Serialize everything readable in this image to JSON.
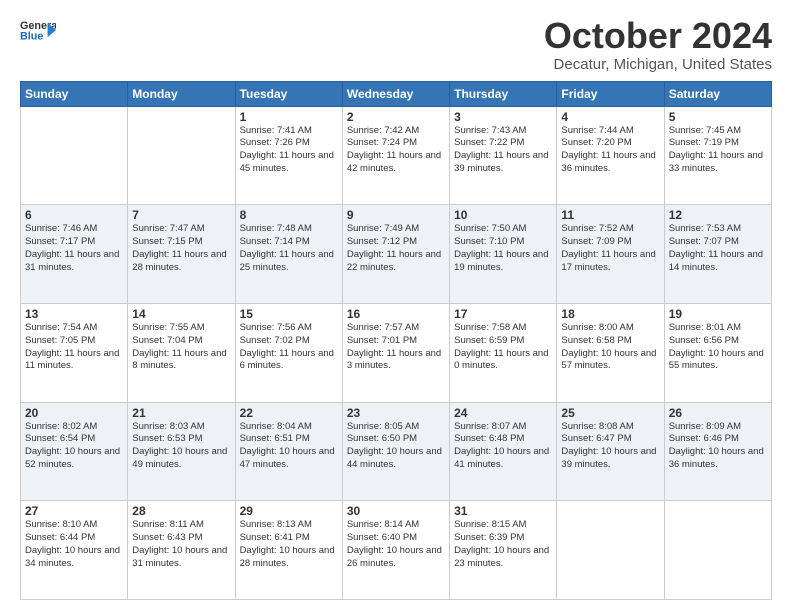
{
  "header": {
    "logo_line1": "General",
    "logo_line2": "Blue",
    "month": "October 2024",
    "location": "Decatur, Michigan, United States"
  },
  "days_of_week": [
    "Sunday",
    "Monday",
    "Tuesday",
    "Wednesday",
    "Thursday",
    "Friday",
    "Saturday"
  ],
  "weeks": [
    [
      {
        "day": "",
        "info": ""
      },
      {
        "day": "",
        "info": ""
      },
      {
        "day": "1",
        "info": "Sunrise: 7:41 AM\nSunset: 7:26 PM\nDaylight: 11 hours and 45 minutes."
      },
      {
        "day": "2",
        "info": "Sunrise: 7:42 AM\nSunset: 7:24 PM\nDaylight: 11 hours and 42 minutes."
      },
      {
        "day": "3",
        "info": "Sunrise: 7:43 AM\nSunset: 7:22 PM\nDaylight: 11 hours and 39 minutes."
      },
      {
        "day": "4",
        "info": "Sunrise: 7:44 AM\nSunset: 7:20 PM\nDaylight: 11 hours and 36 minutes."
      },
      {
        "day": "5",
        "info": "Sunrise: 7:45 AM\nSunset: 7:19 PM\nDaylight: 11 hours and 33 minutes."
      }
    ],
    [
      {
        "day": "6",
        "info": "Sunrise: 7:46 AM\nSunset: 7:17 PM\nDaylight: 11 hours and 31 minutes."
      },
      {
        "day": "7",
        "info": "Sunrise: 7:47 AM\nSunset: 7:15 PM\nDaylight: 11 hours and 28 minutes."
      },
      {
        "day": "8",
        "info": "Sunrise: 7:48 AM\nSunset: 7:14 PM\nDaylight: 11 hours and 25 minutes."
      },
      {
        "day": "9",
        "info": "Sunrise: 7:49 AM\nSunset: 7:12 PM\nDaylight: 11 hours and 22 minutes."
      },
      {
        "day": "10",
        "info": "Sunrise: 7:50 AM\nSunset: 7:10 PM\nDaylight: 11 hours and 19 minutes."
      },
      {
        "day": "11",
        "info": "Sunrise: 7:52 AM\nSunset: 7:09 PM\nDaylight: 11 hours and 17 minutes."
      },
      {
        "day": "12",
        "info": "Sunrise: 7:53 AM\nSunset: 7:07 PM\nDaylight: 11 hours and 14 minutes."
      }
    ],
    [
      {
        "day": "13",
        "info": "Sunrise: 7:54 AM\nSunset: 7:05 PM\nDaylight: 11 hours and 11 minutes."
      },
      {
        "day": "14",
        "info": "Sunrise: 7:55 AM\nSunset: 7:04 PM\nDaylight: 11 hours and 8 minutes."
      },
      {
        "day": "15",
        "info": "Sunrise: 7:56 AM\nSunset: 7:02 PM\nDaylight: 11 hours and 6 minutes."
      },
      {
        "day": "16",
        "info": "Sunrise: 7:57 AM\nSunset: 7:01 PM\nDaylight: 11 hours and 3 minutes."
      },
      {
        "day": "17",
        "info": "Sunrise: 7:58 AM\nSunset: 6:59 PM\nDaylight: 11 hours and 0 minutes."
      },
      {
        "day": "18",
        "info": "Sunrise: 8:00 AM\nSunset: 6:58 PM\nDaylight: 10 hours and 57 minutes."
      },
      {
        "day": "19",
        "info": "Sunrise: 8:01 AM\nSunset: 6:56 PM\nDaylight: 10 hours and 55 minutes."
      }
    ],
    [
      {
        "day": "20",
        "info": "Sunrise: 8:02 AM\nSunset: 6:54 PM\nDaylight: 10 hours and 52 minutes."
      },
      {
        "day": "21",
        "info": "Sunrise: 8:03 AM\nSunset: 6:53 PM\nDaylight: 10 hours and 49 minutes."
      },
      {
        "day": "22",
        "info": "Sunrise: 8:04 AM\nSunset: 6:51 PM\nDaylight: 10 hours and 47 minutes."
      },
      {
        "day": "23",
        "info": "Sunrise: 8:05 AM\nSunset: 6:50 PM\nDaylight: 10 hours and 44 minutes."
      },
      {
        "day": "24",
        "info": "Sunrise: 8:07 AM\nSunset: 6:48 PM\nDaylight: 10 hours and 41 minutes."
      },
      {
        "day": "25",
        "info": "Sunrise: 8:08 AM\nSunset: 6:47 PM\nDaylight: 10 hours and 39 minutes."
      },
      {
        "day": "26",
        "info": "Sunrise: 8:09 AM\nSunset: 6:46 PM\nDaylight: 10 hours and 36 minutes."
      }
    ],
    [
      {
        "day": "27",
        "info": "Sunrise: 8:10 AM\nSunset: 6:44 PM\nDaylight: 10 hours and 34 minutes."
      },
      {
        "day": "28",
        "info": "Sunrise: 8:11 AM\nSunset: 6:43 PM\nDaylight: 10 hours and 31 minutes."
      },
      {
        "day": "29",
        "info": "Sunrise: 8:13 AM\nSunset: 6:41 PM\nDaylight: 10 hours and 28 minutes."
      },
      {
        "day": "30",
        "info": "Sunrise: 8:14 AM\nSunset: 6:40 PM\nDaylight: 10 hours and 26 minutes."
      },
      {
        "day": "31",
        "info": "Sunrise: 8:15 AM\nSunset: 6:39 PM\nDaylight: 10 hours and 23 minutes."
      },
      {
        "day": "",
        "info": ""
      },
      {
        "day": "",
        "info": ""
      }
    ]
  ]
}
